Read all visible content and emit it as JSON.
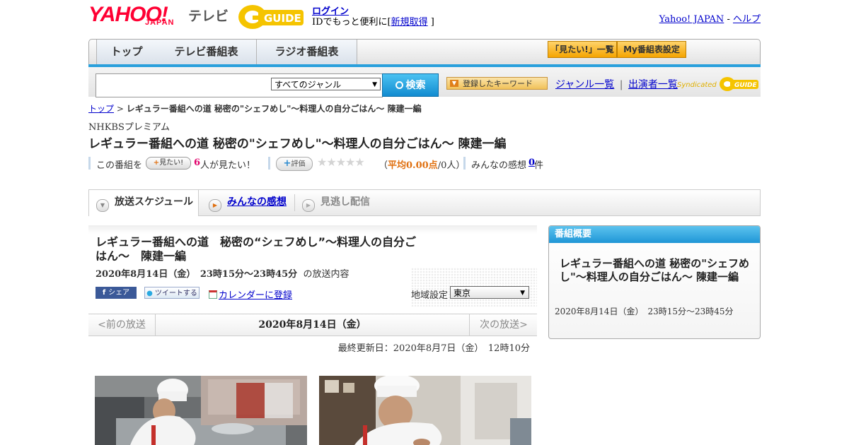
{
  "header": {
    "logo_yahoo": "YAHOO!",
    "logo_japan": "JAPAN",
    "logo_tv": "テレビ",
    "g_guide": "GUIDE",
    "login": "ログイン",
    "login_sub_prefix": "IDでもっと便利に[",
    "register": "新規取得",
    "login_sub_suffix": "]",
    "yahoo_japan_link": "Yahoo! JAPAN",
    "separator": "-",
    "help_link": "ヘルプ"
  },
  "nav": {
    "tabs": [
      "トップ",
      "テレビ番組表",
      "ラジオ番組表"
    ],
    "mitai_list": "「見たい!」一覧",
    "my_schedule": "My番組表設定"
  },
  "search": {
    "genre_selected": "すべてのジャンル",
    "button": "検索",
    "keyword_button": "登録したキーワード",
    "genre_list": "ジャンル一覧",
    "divider": "|",
    "performers": "出演者一覧",
    "syndicated": "Syndicated"
  },
  "breadcrumb": {
    "top": "トップ",
    "sep": ">",
    "current": "レギュラー番組への道 秘密の\"シェフめし\"～料理人の自分ごはん～ 陳建一編"
  },
  "program": {
    "channel": "NHKBSプレミアム",
    "title": "レギュラー番組への道 秘密の\"シェフめし\"～料理人の自分ごはん～ 陳建一編",
    "meta_prefix": "この番組を",
    "mitai_btn": "見たい!",
    "mitai_count": "6",
    "mitai_suffix": "人が見たい！",
    "hyoka_btn": "評価",
    "stars": "★★★★★",
    "avg_open": "（",
    "avg_label": "平均0.00点",
    "avg_rest": "/0人）",
    "kanso_label": "みんなの感想",
    "kanso_count": "0",
    "kanso_suffix": "件"
  },
  "tabs": {
    "schedule": "放送スケジュール",
    "reviews": "みんなの感想",
    "missed": "見逃し配信"
  },
  "detail": {
    "title": "レギュラー番組への道　秘密の“シェフめし”～料理人の自分ごはん～　陳建一編",
    "time": "2020年8月14日（金）　23時15分～23時45分",
    "time_suffix": "の放送内容",
    "share_fb": "シェア",
    "share_tw": "ツイートする",
    "calendar": "カレンダーに登録",
    "region_label": "地域設定",
    "region_value": "東京",
    "prev": "<前の放送",
    "date": "2020年8月14日（金）",
    "next": "次の放送>",
    "updated": "最終更新日：2020年8月7日（金）　12時10分"
  },
  "overview": {
    "header": "番組概要",
    "title": "レギュラー番組への道 秘密の\"シェフめし\"～料理人の自分ごはん～ 陳建一編",
    "time": "2020年8月14日（金）　23時15分～23時45分"
  },
  "colors": {
    "accent_blue": "#2aa0dc",
    "yahoo_red": "#ff0033",
    "link": "#0000cc",
    "highlight_orange": "#e07010"
  }
}
